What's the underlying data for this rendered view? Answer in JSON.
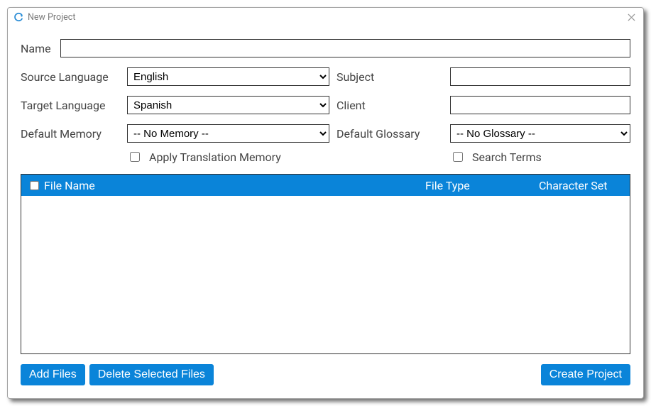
{
  "window": {
    "title": "New Project"
  },
  "form": {
    "name_label": "Name",
    "name_value": "",
    "source_lang_label": "Source Language",
    "source_lang_value": "English",
    "subject_label": "Subject",
    "subject_value": "",
    "target_lang_label": "Target Language",
    "target_lang_value": "Spanish",
    "client_label": "Client",
    "client_value": "",
    "default_memory_label": "Default Memory",
    "default_memory_value": "-- No Memory --",
    "default_glossary_label": "Default Glossary",
    "default_glossary_value": "-- No Glossary --",
    "apply_tm_label": "Apply Translation Memory",
    "apply_tm_checked": false,
    "search_terms_label": "Search Terms",
    "search_terms_checked": false
  },
  "table": {
    "columns": {
      "file_name": "File Name",
      "file_type": "File Type",
      "character_set": "Character Set"
    },
    "rows": []
  },
  "buttons": {
    "add_files": "Add Files",
    "delete_selected": "Delete Selected Files",
    "create_project": "Create Project"
  }
}
